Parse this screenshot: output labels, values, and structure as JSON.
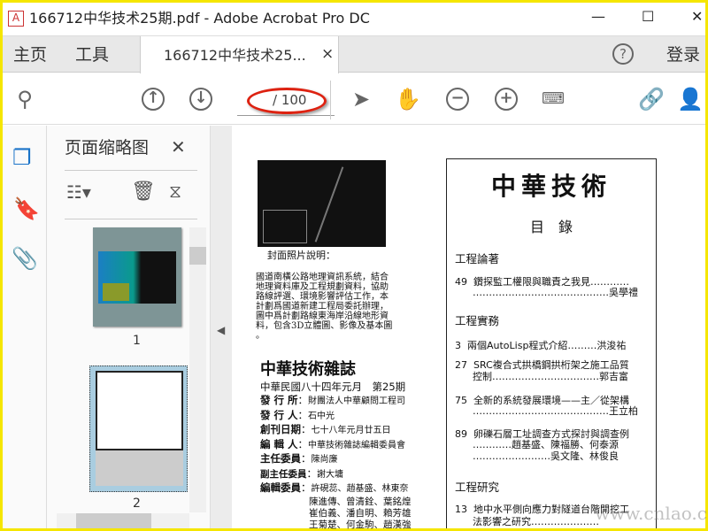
{
  "window": {
    "title": "166712中华技术25期.pdf - Adobe Acrobat Pro DC",
    "minimize": "—",
    "maximize": "☐",
    "close": "✕"
  },
  "tabs": {
    "home": "主页",
    "tools": "工具",
    "document": "166712中华技术25...",
    "close": "×",
    "help": "?",
    "login": "登录"
  },
  "toolbar": {
    "page_current": "",
    "page_total": "/ 100"
  },
  "panel": {
    "title": "页面缩略图",
    "close": "✕",
    "thumbnails": [
      {
        "label": "1"
      },
      {
        "label": "2"
      }
    ]
  },
  "page": {
    "cover_caption_title": "封面照片說明：",
    "cover_caption": [
      "國道南橫公路地理資訊系統，結合",
      "地理資料庫及工程規劃資料，協助",
      "路線評選、環境影響評估工作，本",
      "計劃爲國道新建工程局委託辦理，",
      "圖中爲計劃路線東海岸沿線地形資",
      "料，包含3D立體圖、影像及基本圖",
      "。"
    ],
    "mag_title": "中華技術雜誌",
    "issue": "中華民國八十四年元月　第25期",
    "info": [
      {
        "k": "發 行 所",
        "v": "財團法人中華顧問工程司"
      },
      {
        "k": "發 行 人",
        "v": "石中光"
      },
      {
        "k": "創刊日期",
        "v": "七十八年元月廿五日"
      },
      {
        "k": "編 輯 人",
        "v": "中華技術雜誌編輯委員會"
      },
      {
        "k": "主任委員",
        "v": "陳尚廉"
      },
      {
        "k": "副主任委員",
        "v": "謝大墉"
      },
      {
        "k": "編輯委員",
        "v": "許硯蕊、趙基盛、林東奈"
      }
    ],
    "committee_more": [
      "陳進傳、曾清銓、葉銘煌",
      "崔伯義、潘自明、賴芳雄",
      "王菊楚、何金駒、趙漢強"
    ],
    "toc_title": "中華技術",
    "toc_sub": "目　錄",
    "sections": [
      {
        "name": "工程論著",
        "items": [
          {
            "p": "49",
            "t": "鑽探監工權限與職責之我見…………",
            "a": "……………………………………吳學禮"
          }
        ]
      },
      {
        "name": "工程實務",
        "items": [
          {
            "p": "3",
            "t": "兩個AutoLisp程式介紹………洪浚祐",
            "a": ""
          },
          {
            "p": "27",
            "t": "SRC複合式拱橋鋼拱桁架之施工品質",
            "a": "控制……………………………郭吉富"
          },
          {
            "p": "75",
            "t": "全新的系統發展環境——主／從架構",
            "a": "……………………………………王立柏"
          },
          {
            "p": "89",
            "t": "卵礫石層工址調查方式探討與調查例",
            "a": "…………趙基盛、陳福勝、何泰源"
          }
        ]
      },
      {
        "name": "工程研究",
        "items": [
          {
            "p": "13",
            "t": "地中水平側向應力對隧道台階開挖工",
            "a": "法影響之研究…………………"
          }
        ]
      }
    ],
    "toc_extra": "……………………吳文隆、林俊良",
    "watermark": "www.cnlao.com"
  }
}
